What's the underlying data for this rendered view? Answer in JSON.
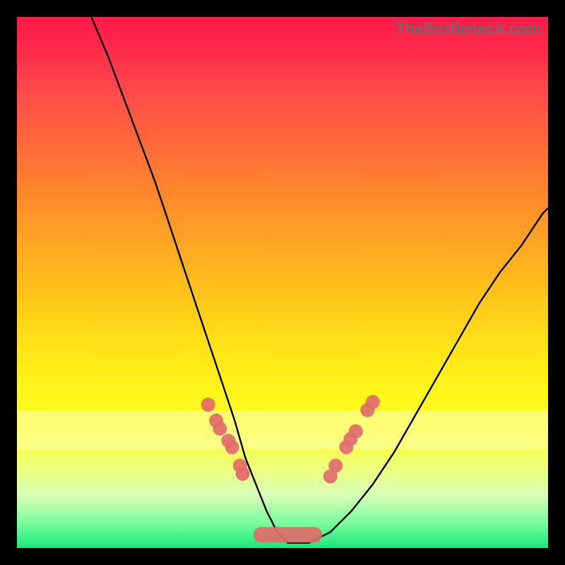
{
  "watermark": "TheBottleneck.com",
  "colors": {
    "dot": "#e26b6b",
    "curve": "#000000",
    "background_top": "#ff1a4a",
    "background_bottom": "#18e87a"
  },
  "chart_data": {
    "type": "line",
    "title": "",
    "xlabel": "",
    "ylabel": "",
    "xlim": [
      0,
      100
    ],
    "ylim": [
      0,
      100
    ],
    "curve": {
      "x": [
        14,
        17,
        20,
        23,
        26,
        29,
        32,
        35,
        38,
        41,
        43,
        45,
        47,
        49,
        51,
        55,
        59,
        63,
        67,
        71,
        75,
        79,
        83,
        87,
        91,
        95,
        99,
        100
      ],
      "y": [
        100,
        93,
        85,
        77,
        69,
        60,
        51,
        42,
        33,
        24,
        17,
        12,
        7,
        3,
        1,
        1,
        3,
        7,
        12,
        18,
        25,
        32,
        39,
        46,
        52,
        57,
        63,
        64
      ]
    },
    "yellow_band": {
      "y_from": 19,
      "y_to": 26
    },
    "dots_left": {
      "x": [
        36.0,
        37.5,
        38.2,
        40.5,
        39.8,
        42.0,
        42.5
      ],
      "y": [
        27.0,
        24.0,
        22.5,
        19.0,
        20.2,
        15.5,
        14.0
      ]
    },
    "dots_right": {
      "x": [
        59.0,
        60.0,
        62.0,
        62.8,
        63.8,
        66.0,
        67.0
      ],
      "y": [
        13.5,
        15.5,
        19.0,
        20.5,
        22.0,
        26.0,
        27.5
      ]
    },
    "worm": {
      "x_from": 46,
      "x_to": 56,
      "y": 2.5
    }
  }
}
